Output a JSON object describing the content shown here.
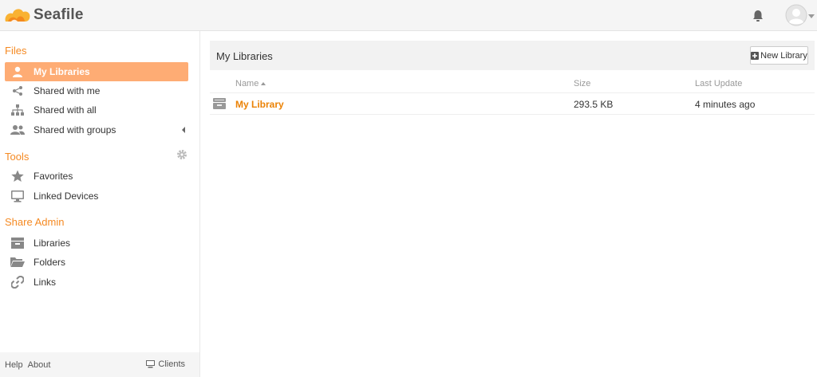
{
  "app": {
    "name": "Seafile",
    "accent_color": "#f58a23",
    "active_bg_color": "#feac74",
    "link_color": "#eb8205"
  },
  "header": {
    "notification_icon": "bell-icon",
    "user_icon": "user-avatar-icon"
  },
  "sidebar": {
    "sections": {
      "files": "Files",
      "tools": "Tools",
      "share_admin": "Share Admin"
    },
    "files_items": [
      {
        "label": "My Libraries",
        "icon": "user-icon",
        "active": true
      },
      {
        "label": "Shared with me",
        "icon": "share-icon",
        "active": false
      },
      {
        "label": "Shared with all",
        "icon": "sitemap-icon",
        "active": false
      },
      {
        "label": "Shared with groups",
        "icon": "group-icon",
        "active": false
      }
    ],
    "tools_items": [
      {
        "label": "Favorites",
        "icon": "star-icon"
      },
      {
        "label": "Linked Devices",
        "icon": "monitor-icon"
      }
    ],
    "share_admin_items": [
      {
        "label": "Libraries",
        "icon": "library-icon"
      },
      {
        "label": "Folders",
        "icon": "folder-icon"
      },
      {
        "label": "Links",
        "icon": "link-icon"
      }
    ],
    "footer": {
      "help": "Help",
      "about": "About",
      "clients": "Clients"
    }
  },
  "main": {
    "title": "My Libraries",
    "new_library_label": "New Library",
    "columns": {
      "name": "Name",
      "size": "Size",
      "last_update": "Last Update"
    },
    "rows": [
      {
        "name": "My Library",
        "size": "293.5 KB",
        "last_update": "4 minutes ago"
      }
    ]
  }
}
